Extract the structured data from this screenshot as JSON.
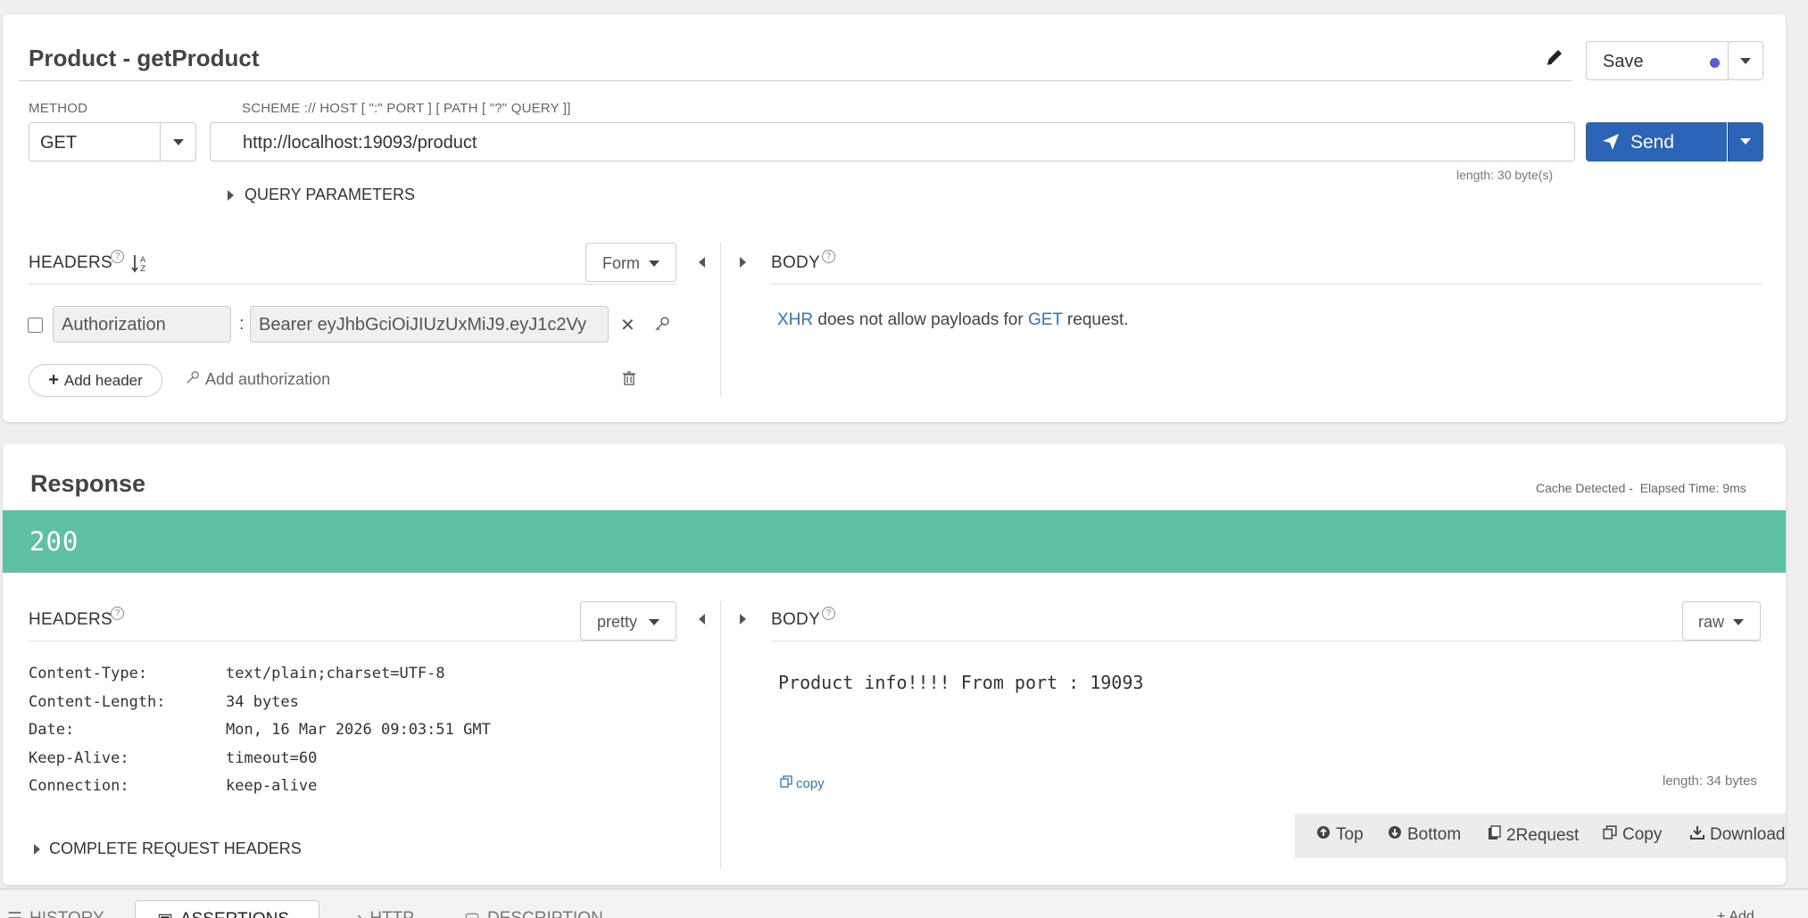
{
  "request": {
    "title": "Product - getProduct",
    "save_label": "Save",
    "method_label": "METHOD",
    "method_value": "GET",
    "url_label": "SCHEME :// HOST [ \":\" PORT ] [ PATH [ \"?\" QUERY ]]",
    "url_value": "http://localhost:19093/product",
    "send_label": "Send",
    "url_length": "length: 30 byte(s)",
    "query_params_label": "QUERY PARAMETERS",
    "headers_label": "HEADERS",
    "headers_mode": "Form",
    "header_name": "Authorization",
    "header_separator": ":",
    "header_value": "Bearer eyJhbGciOiJIUzUxMiJ9.eyJ1c2Vy",
    "add_header_label": "Add header",
    "add_authorization_label": "Add authorization",
    "body_label": "BODY",
    "body_msg_xhr": "XHR",
    "body_msg_mid": " does not allow payloads for ",
    "body_msg_get": "GET",
    "body_msg_end": " request."
  },
  "response": {
    "title": "Response",
    "meta": "Cache Detected -  Elapsed Time: 9ms",
    "status_code": "200",
    "headers_label": "HEADERS",
    "headers_mode": "pretty",
    "headers": [
      {
        "name": "Content-Type:",
        "value": "text/plain;charset=UTF-8"
      },
      {
        "name": "Content-Length:",
        "value": "34 bytes"
      },
      {
        "name": "Date:",
        "value": "Mon, 16 Mar 2026 09:03:51 GMT"
      },
      {
        "name": "Keep-Alive:",
        "value": "timeout=60"
      },
      {
        "name": "Connection:",
        "value": "keep-alive"
      }
    ],
    "complete_headers_label": "COMPLETE REQUEST HEADERS",
    "body_label": "BODY",
    "body_mode": "raw",
    "body_text": "Product info!!!! From port : 19093",
    "copy_label": "copy",
    "body_length": "length: 34 bytes",
    "toolbar": {
      "top": "Top",
      "bottom": "Bottom",
      "to_request": "2Request",
      "copy": "Copy",
      "download": "Download"
    }
  },
  "bottom_tabs": {
    "history": "HISTORY",
    "assertions": "ASSERTIONS",
    "http": "HTTP",
    "description": "DESCRIPTION",
    "add": "Add"
  },
  "colors": {
    "status_ok": "#5ec1a6",
    "primary": "#2c64b8",
    "link": "#2b77c5"
  }
}
